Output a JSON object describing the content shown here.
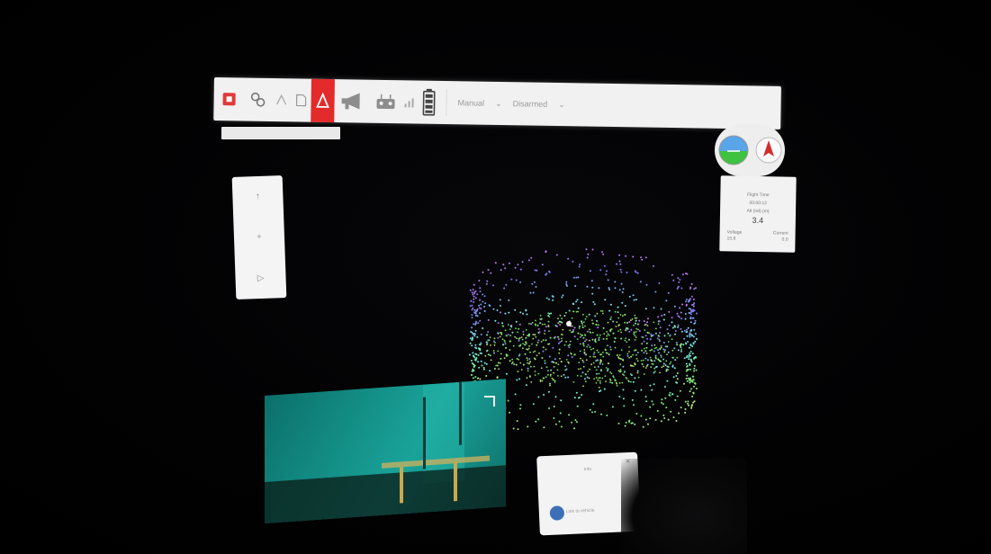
{
  "toolbar": {
    "mode_label": "Manual",
    "mode_value": "Disarmed",
    "icons": [
      "stop-icon",
      "settings-icon",
      "vehicle-icon",
      "waypoint-icon",
      "alert-icon",
      "megaphone-icon",
      "joystick-icon",
      "signal-icon",
      "battery-icon"
    ]
  },
  "joystick": {
    "up": "↑",
    "center": "∘",
    "right": "▷"
  },
  "info": {
    "row1": "Flight Time",
    "row2": "00:00:12",
    "row3": "Alt (rel) (m)",
    "big": "3.4",
    "stat1_label": "Voltage",
    "stat1_value": "15.8",
    "stat2_label": "Current",
    "stat2_value": "0.0"
  },
  "notification": {
    "title": "Info",
    "footer": "Link to vehicle"
  },
  "colors": {
    "alert": "#e32b2b",
    "horizon_sky": "#5aa4e8",
    "horizon_ground": "#3fc23f",
    "compass_arrow": "#d42b2b"
  }
}
